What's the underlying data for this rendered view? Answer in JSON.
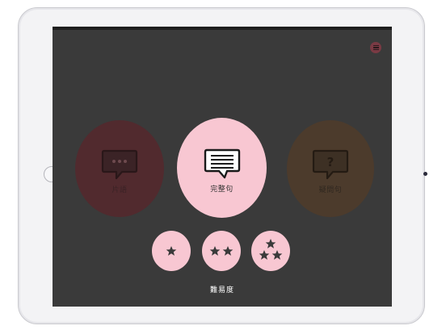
{
  "header": {
    "menu_icon": "hamburger-menu-icon"
  },
  "modes": [
    {
      "label": "片語",
      "icon": "speech-bubble-ellipsis-icon",
      "selected": false
    },
    {
      "label": "完整句",
      "icon": "speech-bubble-lines-icon",
      "selected": true
    },
    {
      "label": "疑問句",
      "icon": "speech-bubble-question-icon",
      "selected": false
    }
  ],
  "difficulty": {
    "label": "難易度",
    "levels": [
      {
        "stars": 1,
        "icon": "one-star-icon"
      },
      {
        "stars": 2,
        "icon": "two-stars-icon"
      },
      {
        "stars": 3,
        "icon": "three-stars-icon"
      }
    ]
  },
  "colors": {
    "screen_background": "#3a3a3a",
    "accent_pink": "#f8c7d2",
    "fragment_dimmed": "#512a2e",
    "question_dimmed": "#4c3b2c",
    "menu_button": "#7a3a44"
  }
}
